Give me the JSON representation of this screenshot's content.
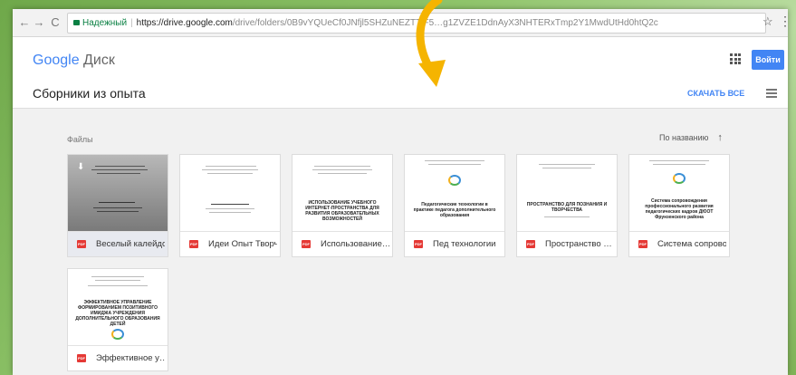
{
  "browser": {
    "back": "←",
    "forward": "→",
    "reload": "C",
    "secure_label": "Надежный",
    "url_host": "https://drive.google.com",
    "url_path": "/drive/folders/0B9vYQUeCf0JNfjl5SHZuNEZTTjF5…g1ZVZE1DdnAyX3NHTERxTmp2Y1MwdUtHd0htQ2c",
    "star": "☆",
    "menu": "⋮"
  },
  "header": {
    "logo_google": "Google",
    "logo_product": "Диск",
    "signin_label": "Войти"
  },
  "toolbar": {
    "folder_title": "Сборники из опыта",
    "download_all": "СКАЧАТЬ ВСЕ"
  },
  "content": {
    "section_label": "Файлы",
    "sort_label": "По названию",
    "sort_arrow": "↑",
    "files": [
      {
        "name": "Веселый калейдоскоп",
        "type": "PDF"
      },
      {
        "name": "Идеи Опыт Творчество",
        "type": "PDF"
      },
      {
        "name": "Использование…",
        "type": "PDF"
      },
      {
        "name": "Пед технологии",
        "type": "PDF"
      },
      {
        "name": "Пространство …",
        "type": "PDF"
      },
      {
        "name": "Система сопровождения",
        "type": "PDF"
      },
      {
        "name": "Эффективное у…",
        "type": "PDF"
      }
    ],
    "thumb_titles": {
      "t3": "ИСПОЛЬЗОВАНИЕ УЧЕБНОГО ИНТЕРНЕТ-ПРОСТРАНСТВА ДЛЯ РАЗВИТИЯ ОБРАЗОВАТЕЛЬНЫХ ВОЗМОЖНОСТЕЙ",
      "t4": "Педагогические технологии в практике педагога дополнительного образования",
      "t5": "ПРОСТРАНСТВО ДЛЯ ПОЗНАНИЯ И ТВОРЧЕСТВА",
      "t6": "Система сопровождения профессионального развития педагогических кадров ДЮОТ Фрунзенского района",
      "t7": "ЭФФЕКТИВНОЕ УПРАВЛЕНИЕ ФОРМИРОВАНИЕМ ПОЗИТИВНОГО ИМИДЖА УЧРЕЖДЕНИЯ ДОПОЛНИТЕЛЬНОГО ОБРАЗОВАНИЯ ДЕТЕЙ"
    }
  },
  "colors": {
    "accent": "#4285f4",
    "pdf": "#e53935",
    "arrow": "#f5b400"
  },
  "icons": [
    "back-icon",
    "forward-icon",
    "reload-icon",
    "lock-icon",
    "star-icon",
    "menu-icon",
    "apps-icon",
    "list-view-icon",
    "pdf-icon",
    "download-icon",
    "sort-arrow-icon",
    "pointer-arrow"
  ]
}
